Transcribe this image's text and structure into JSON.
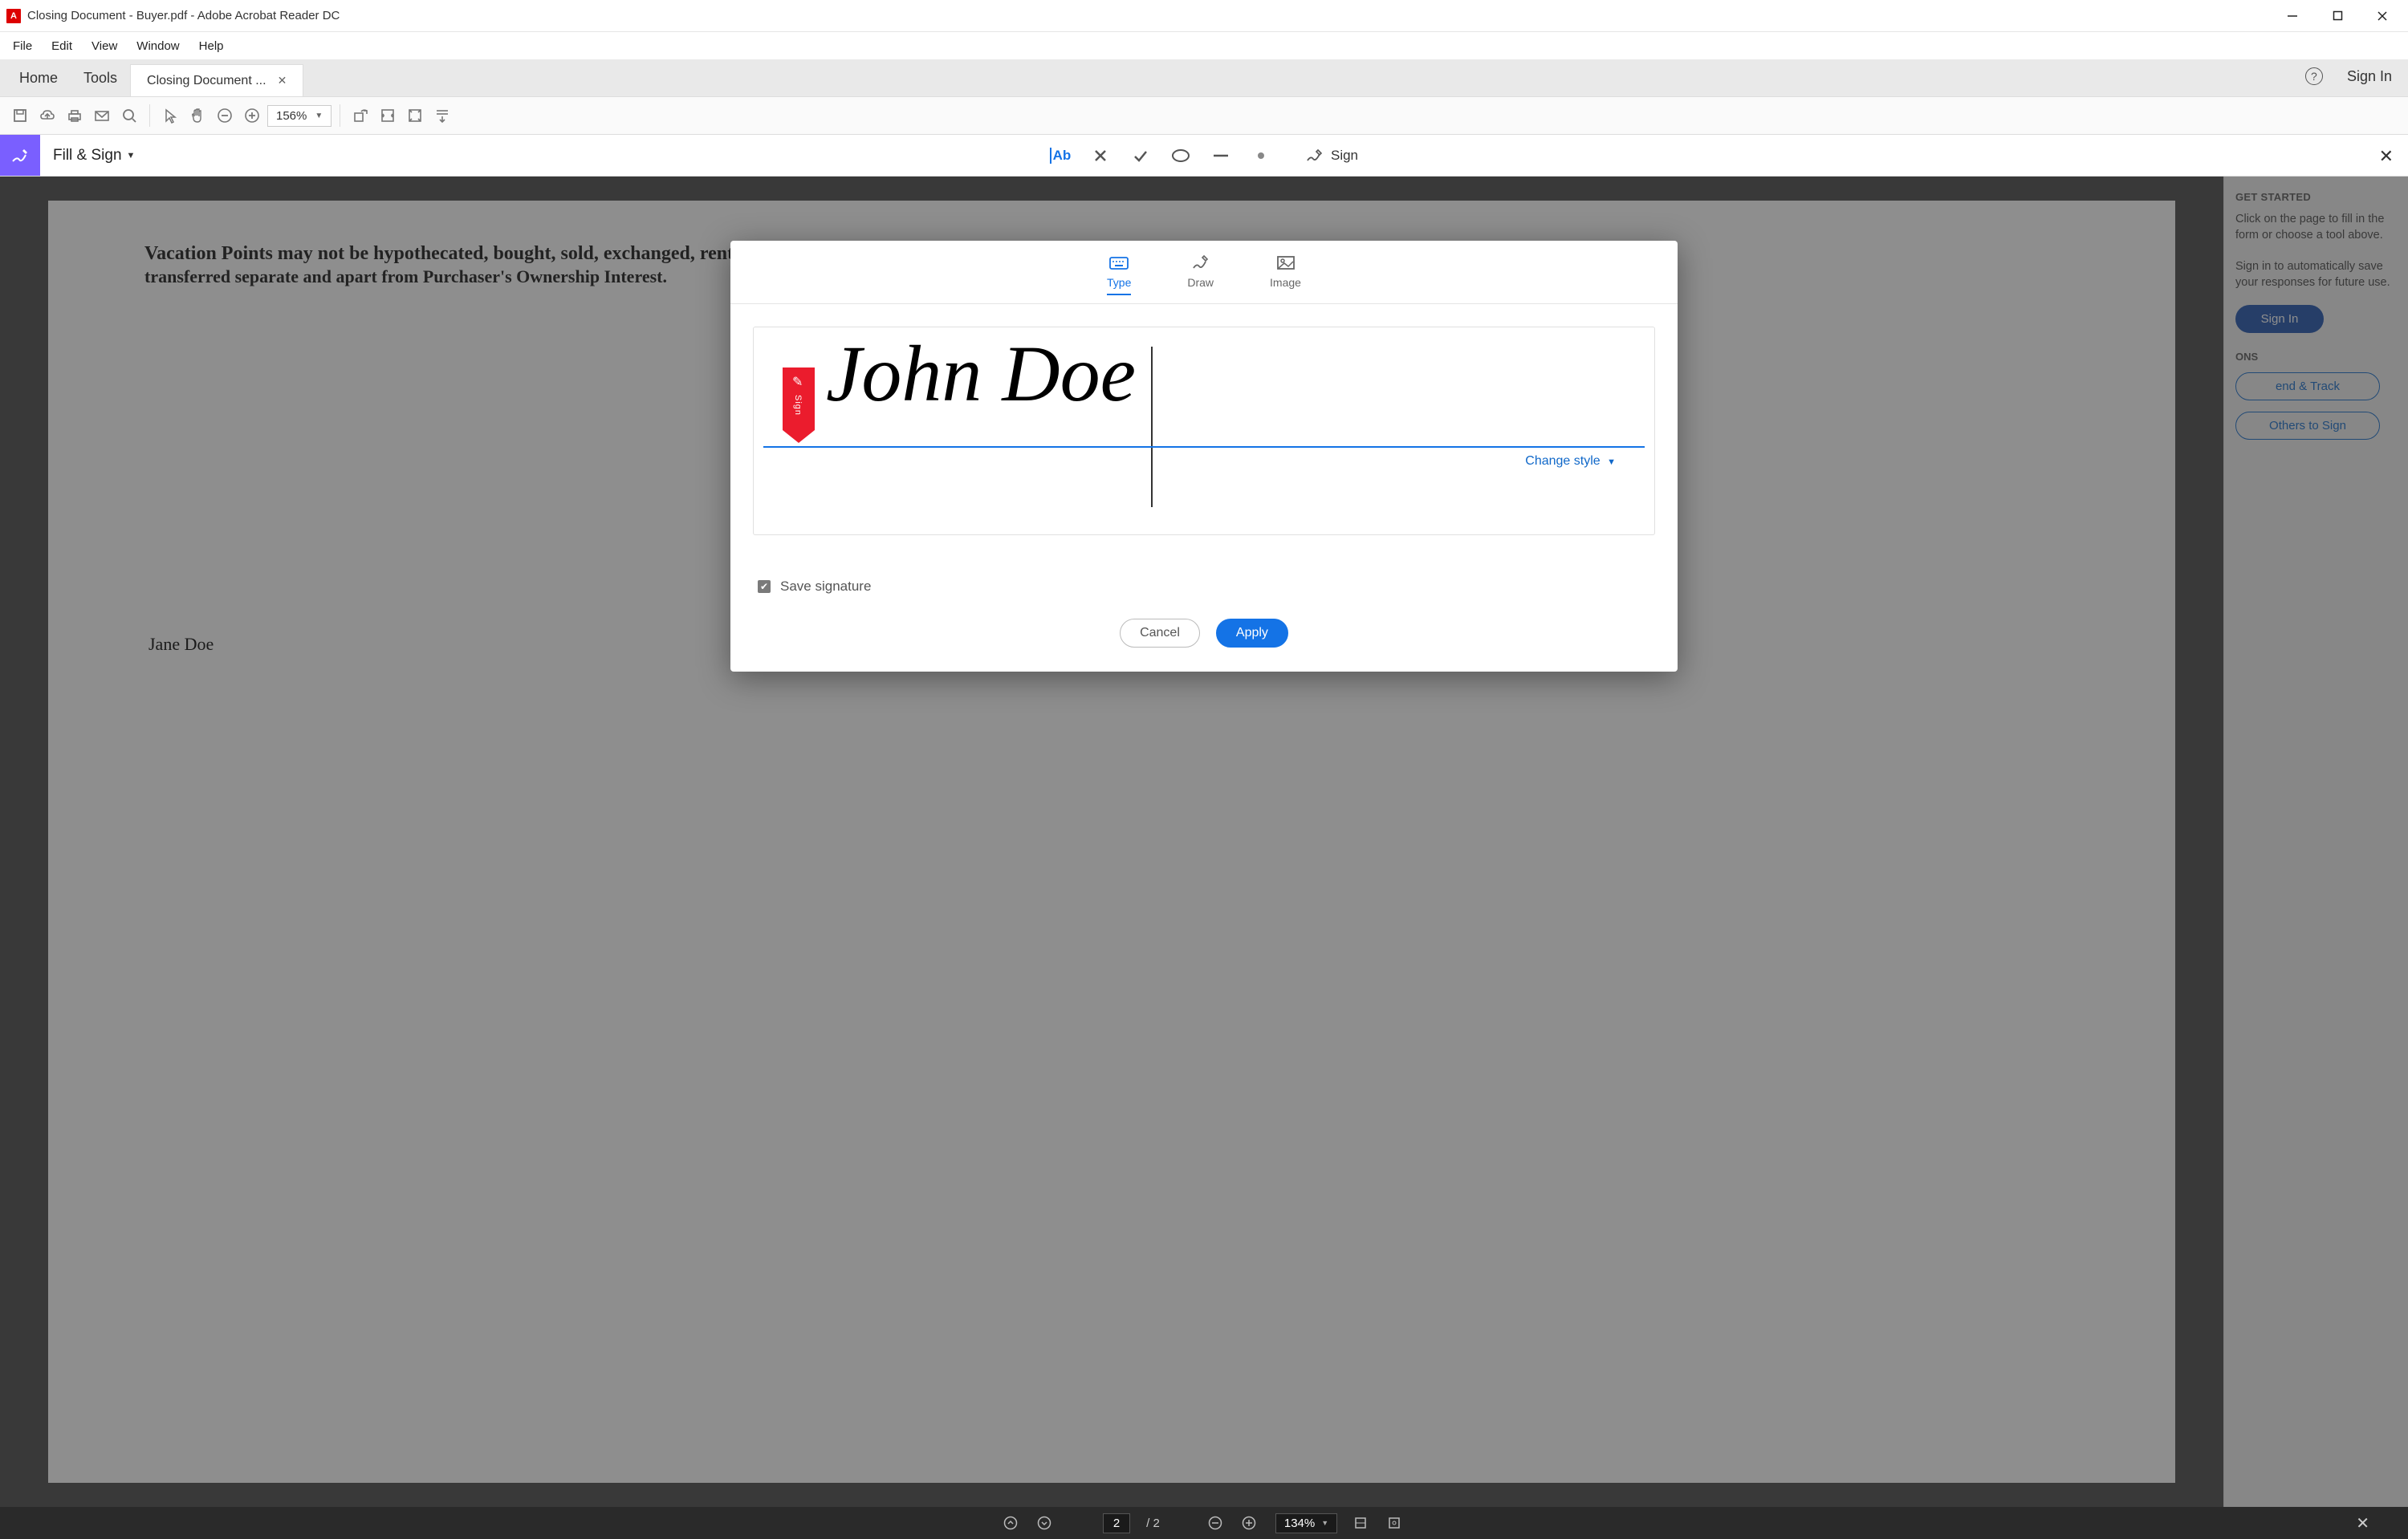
{
  "window": {
    "title": "Closing Document - Buyer.pdf - Adobe Acrobat Reader DC"
  },
  "menu": {
    "file": "File",
    "edit": "Edit",
    "view": "View",
    "window": "Window",
    "help": "Help"
  },
  "tabs": {
    "home": "Home",
    "tools": "Tools",
    "active": "Closing Document ..."
  },
  "topright": {
    "signin": "Sign In"
  },
  "toolbar": {
    "zoom": "156%"
  },
  "fillsign": {
    "label": "Fill & Sign",
    "sign_label": "Sign"
  },
  "rightpanel": {
    "heading": "GET STARTED",
    "p1": "Click on the page to fill in the form or choose a tool above.",
    "p2": "Sign in to automatically save your responses for future use.",
    "signin_btn": "Sign In",
    "options_hd": "ONS",
    "opt1": "end & Track",
    "opt2": "Others to Sign"
  },
  "document": {
    "heading": "Vacation Points may not be hypothecated, bought, sold, exchanged, rented or otherwise",
    "heading2": "transferred separate and apart from Purchaser's Ownership Interest.",
    "name_below": "Jane Doe"
  },
  "bottombar": {
    "page_current": "2",
    "page_total": "2",
    "zoom": "134%"
  },
  "dialog": {
    "tabs": {
      "type": "Type",
      "draw": "Draw",
      "image": "Image"
    },
    "sign_flag": "Sign",
    "signature_value": "John Doe",
    "change_style": "Change style",
    "save_label": "Save signature",
    "cancel": "Cancel",
    "apply": "Apply"
  }
}
